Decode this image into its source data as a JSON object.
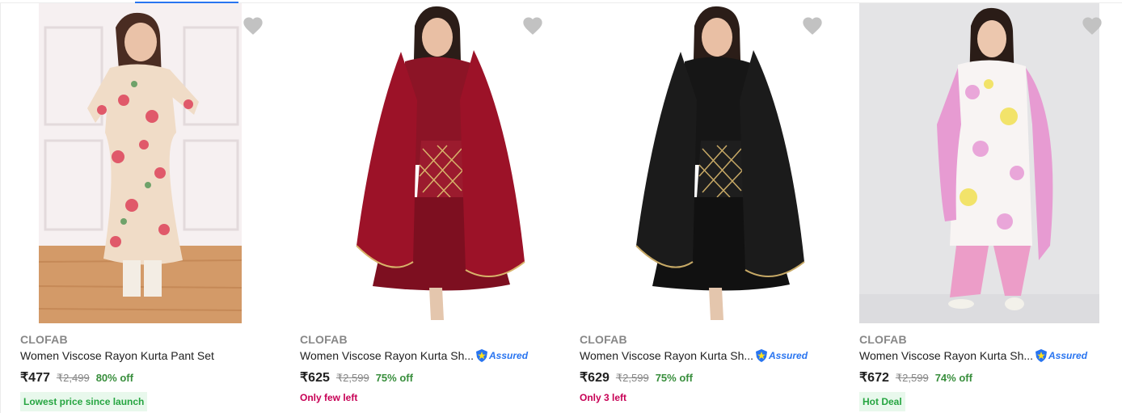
{
  "products": [
    {
      "brand": "CLOFAB",
      "title": "Women Viscose Rayon Kurta Pant Set",
      "price": "₹477",
      "mrp": "₹2,499",
      "discount": "80% off",
      "assured": false,
      "tag": "Lowest price since launch",
      "tag_style": "green",
      "image": "woman-in-floral-printed-kurta-set"
    },
    {
      "brand": "CLOFAB",
      "title": "Women Viscose Rayon Kurta Sh...",
      "price": "₹625",
      "mrp": "₹2,599",
      "discount": "75% off",
      "assured": true,
      "tag": "Only few left",
      "tag_style": "red",
      "image": "woman-in-maroon-kurta-sharara-with-dupatta"
    },
    {
      "brand": "CLOFAB",
      "title": "Women Viscose Rayon Kurta Sh...",
      "price": "₹629",
      "mrp": "₹2,599",
      "discount": "75% off",
      "assured": true,
      "tag": "Only 3 left",
      "tag_style": "red",
      "image": "woman-in-black-kurta-sharara-with-dupatta"
    },
    {
      "brand": "CLOFAB",
      "title": "Women Viscose Rayon Kurta Sh...",
      "price": "₹672",
      "mrp": "₹2,599",
      "discount": "74% off",
      "assured": true,
      "tag": "Hot Deal",
      "tag_style": "green",
      "image": "woman-in-white-pink-floral-kurta-pant-set"
    }
  ],
  "assured_label": "Assured",
  "colors": {
    "accent": "#2874f0",
    "discount": "#388e3c",
    "green_badge_text": "#26a541",
    "green_badge_bg": "#e8f8ec",
    "low_stock": "#c70055",
    "heart": "#c2c2c2"
  }
}
